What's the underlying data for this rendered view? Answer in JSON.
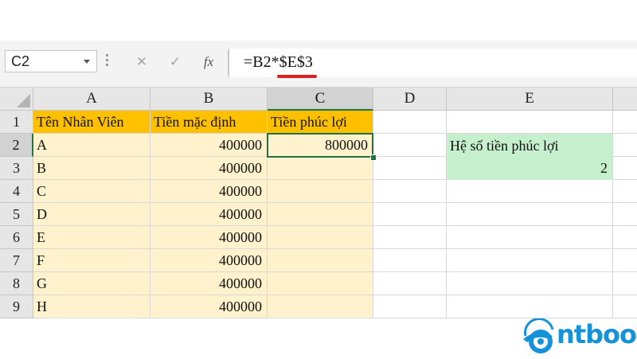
{
  "formula_bar": {
    "name_box": "C2",
    "cancel_icon": "✕",
    "enter_icon": "✓",
    "function_icon": "fx",
    "formula": "=B2*$E$3"
  },
  "columns": [
    "A",
    "B",
    "C",
    "D",
    "E"
  ],
  "rows": [
    "1",
    "2",
    "3",
    "4",
    "5",
    "6",
    "7",
    "8",
    "9"
  ],
  "headers": {
    "a": "Tên Nhân Viên",
    "b": "Tiền mặc định",
    "c": "Tiền phúc lợi"
  },
  "data_rows": [
    {
      "name": "A",
      "base": "400000",
      "bonus": "800000"
    },
    {
      "name": "B",
      "base": "400000",
      "bonus": ""
    },
    {
      "name": "C",
      "base": "400000",
      "bonus": ""
    },
    {
      "name": "D",
      "base": "400000",
      "bonus": ""
    },
    {
      "name": "E",
      "base": "400000",
      "bonus": ""
    },
    {
      "name": "F",
      "base": "400000",
      "bonus": ""
    },
    {
      "name": "G",
      "base": "400000",
      "bonus": ""
    },
    {
      "name": "H",
      "base": "400000",
      "bonus": ""
    }
  ],
  "coefficient": {
    "label": "Hệ số tiền phúc lợi",
    "value": "2"
  },
  "selected_cell": "C2",
  "colors": {
    "header_fill": "#ffc000",
    "data_fill": "#fff2cc",
    "coefficient_fill": "#c6efce",
    "selection": "#217346",
    "formula_underline": "#e02020",
    "brand": "#1592d8"
  },
  "logo": {
    "text": "ntbook"
  }
}
